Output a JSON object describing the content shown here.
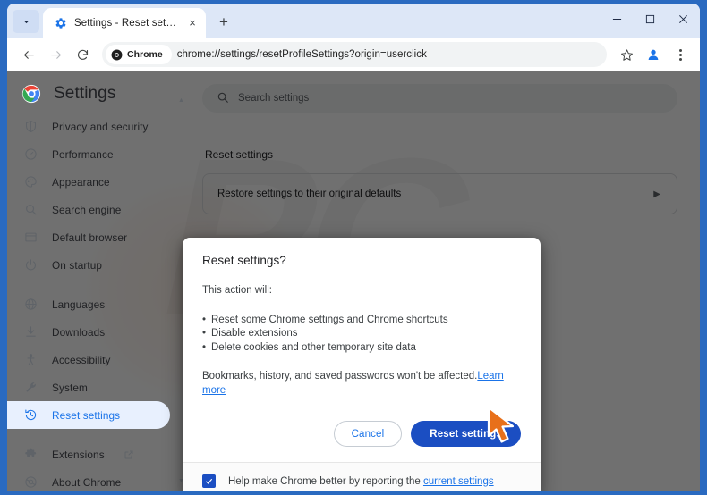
{
  "window": {
    "minimize_label": "Minimize",
    "maximize_label": "Maximize",
    "close_label": "Close"
  },
  "tabstrip": {
    "tab_search_label": "Search tabs",
    "tabs": [
      {
        "title": "Settings - Reset settings",
        "favicon": "gear-icon",
        "close_label": "×"
      }
    ],
    "new_tab_label": "+"
  },
  "toolbar": {
    "back_label": "←",
    "forward_label": "→",
    "reload_label": "⟳",
    "chrome_chip_label": "Chrome",
    "url": "chrome://settings/resetProfileSettings?origin=userclick",
    "bookmark_label": "Bookmark this tab",
    "profile_label": "Profile",
    "menu_label": "Customize and control Google Chrome"
  },
  "sidebar": {
    "title": "Settings",
    "logo": "chrome-logo-icon",
    "items": [
      {
        "label": "Privacy and security",
        "icon": "shield-icon",
        "selected": false
      },
      {
        "label": "Performance",
        "icon": "speedometer-icon",
        "selected": false
      },
      {
        "label": "Appearance",
        "icon": "palette-icon",
        "selected": false
      },
      {
        "label": "Search engine",
        "icon": "magnifier-icon",
        "selected": false
      },
      {
        "label": "Default browser",
        "icon": "browser-window-icon",
        "selected": false
      },
      {
        "label": "On startup",
        "icon": "power-icon",
        "selected": false
      },
      {
        "label": "Languages",
        "icon": "globe-icon",
        "selected": false
      },
      {
        "label": "Downloads",
        "icon": "download-icon",
        "selected": false
      },
      {
        "label": "Accessibility",
        "icon": "accessibility-icon",
        "selected": false
      },
      {
        "label": "System",
        "icon": "wrench-icon",
        "selected": false
      },
      {
        "label": "Reset settings",
        "icon": "history-icon",
        "selected": true
      },
      {
        "label": "Extensions",
        "icon": "puzzle-icon",
        "selected": false,
        "external": true
      },
      {
        "label": "About Chrome",
        "icon": "chrome-outline-icon",
        "selected": false
      }
    ],
    "scroll_up_label": "▲",
    "scroll_down_label": "▼"
  },
  "main": {
    "search_placeholder": "Search settings",
    "section_title": "Reset settings",
    "card_label": "Restore settings to their original defaults",
    "card_chevron": "▶"
  },
  "dialog": {
    "title": "Reset settings?",
    "intro": "This action will:",
    "bullets": [
      "Reset some Chrome settings and Chrome shortcuts",
      "Disable extensions",
      "Delete cookies and other temporary site data"
    ],
    "note": "Bookmarks, history, and saved passwords won't be affected.",
    "note_link": "Learn more",
    "cancel_label": "Cancel",
    "confirm_label": "Reset settings",
    "checkbox_checked": true,
    "checkbox_text": "Help make Chrome better by reporting the ",
    "checkbox_link": "current settings"
  },
  "colors": {
    "accent_blue": "#1a73e8",
    "primary_button": "#1b4ec2",
    "window_frame": "#2a6ac0",
    "selected_nav_bg": "#e8f0fe",
    "cursor_orange": "#e8701a"
  }
}
